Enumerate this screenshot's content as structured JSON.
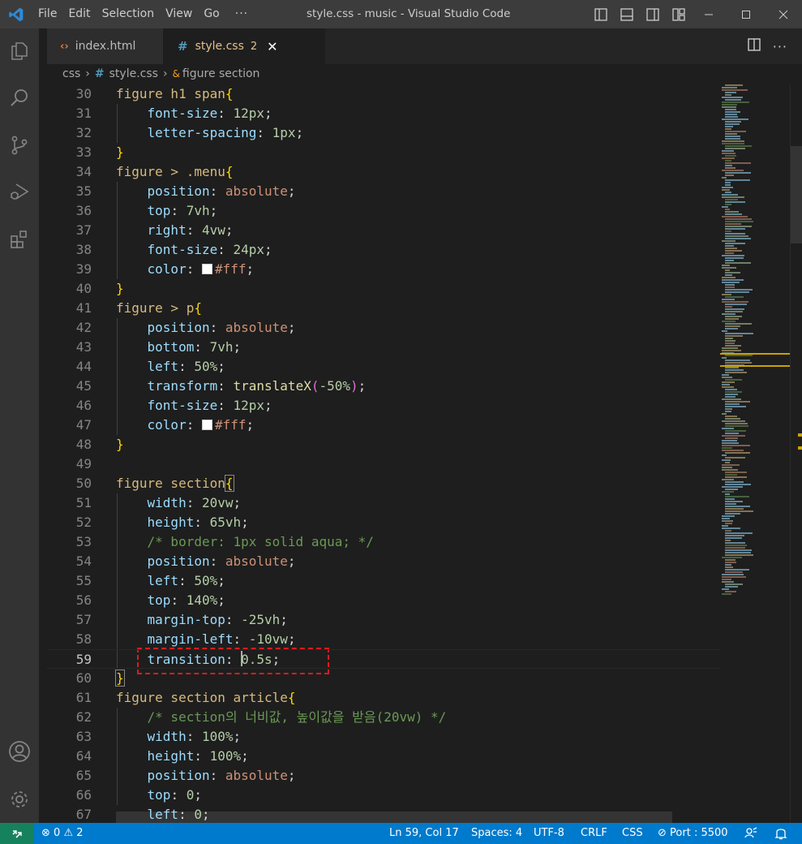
{
  "window": {
    "title": "style.css - music - Visual Studio Code",
    "menu": [
      "File",
      "Edit",
      "Selection",
      "View",
      "Go"
    ],
    "menu_more": "···"
  },
  "tabs": [
    {
      "label": "index.html",
      "icon": "html-file-icon"
    },
    {
      "label": "style.css",
      "icon": "css-file-icon",
      "badge": "2",
      "close": "✕",
      "active": true
    }
  ],
  "breadcrumb": {
    "folder": "css",
    "file": "style.css",
    "symbol": "figure section"
  },
  "editor": {
    "current_line": 59,
    "lines": [
      {
        "n": "30",
        "tokens": [
          [
            "sel",
            "figure h1 span"
          ],
          [
            "brace",
            "{"
          ]
        ]
      },
      {
        "n": "31",
        "tokens": [
          [
            "ws",
            "    "
          ],
          [
            "prop",
            "font-size"
          ],
          [
            "punc",
            ": "
          ],
          [
            "num",
            "12px"
          ],
          [
            "punc",
            ";"
          ]
        ]
      },
      {
        "n": "32",
        "tokens": [
          [
            "ws",
            "    "
          ],
          [
            "prop",
            "letter-spacing"
          ],
          [
            "punc",
            ": "
          ],
          [
            "num",
            "1px"
          ],
          [
            "punc",
            ";"
          ]
        ]
      },
      {
        "n": "33",
        "tokens": [
          [
            "brace",
            "}"
          ]
        ]
      },
      {
        "n": "34",
        "tokens": [
          [
            "sel",
            "figure > .menu"
          ],
          [
            "brace",
            "{"
          ]
        ]
      },
      {
        "n": "35",
        "tokens": [
          [
            "ws",
            "    "
          ],
          [
            "prop",
            "position"
          ],
          [
            "punc",
            ": "
          ],
          [
            "val",
            "absolute"
          ],
          [
            "punc",
            ";"
          ]
        ]
      },
      {
        "n": "36",
        "tokens": [
          [
            "ws",
            "    "
          ],
          [
            "prop",
            "top"
          ],
          [
            "punc",
            ": "
          ],
          [
            "num",
            "7vh"
          ],
          [
            "punc",
            ";"
          ]
        ]
      },
      {
        "n": "37",
        "tokens": [
          [
            "ws",
            "    "
          ],
          [
            "prop",
            "right"
          ],
          [
            "punc",
            ": "
          ],
          [
            "num",
            "4vw"
          ],
          [
            "punc",
            ";"
          ]
        ]
      },
      {
        "n": "38",
        "tokens": [
          [
            "ws",
            "    "
          ],
          [
            "prop",
            "font-size"
          ],
          [
            "punc",
            ": "
          ],
          [
            "num",
            "24px"
          ],
          [
            "punc",
            ";"
          ]
        ]
      },
      {
        "n": "39",
        "tokens": [
          [
            "ws",
            "    "
          ],
          [
            "prop",
            "color"
          ],
          [
            "punc",
            ": "
          ],
          [
            "swatch",
            ""
          ],
          [
            "val",
            "#fff"
          ],
          [
            "punc",
            ";"
          ]
        ]
      },
      {
        "n": "40",
        "tokens": [
          [
            "brace",
            "}"
          ]
        ]
      },
      {
        "n": "41",
        "tokens": [
          [
            "sel",
            "figure > p"
          ],
          [
            "brace",
            "{"
          ]
        ]
      },
      {
        "n": "42",
        "tokens": [
          [
            "ws",
            "    "
          ],
          [
            "prop",
            "position"
          ],
          [
            "punc",
            ": "
          ],
          [
            "val",
            "absolute"
          ],
          [
            "punc",
            ";"
          ]
        ]
      },
      {
        "n": "43",
        "tokens": [
          [
            "ws",
            "    "
          ],
          [
            "prop",
            "bottom"
          ],
          [
            "punc",
            ": "
          ],
          [
            "num",
            "7vh"
          ],
          [
            "punc",
            ";"
          ]
        ]
      },
      {
        "n": "44",
        "tokens": [
          [
            "ws",
            "    "
          ],
          [
            "prop",
            "left"
          ],
          [
            "punc",
            ": "
          ],
          [
            "num",
            "50%"
          ],
          [
            "punc",
            ";"
          ]
        ]
      },
      {
        "n": "45",
        "tokens": [
          [
            "ws",
            "    "
          ],
          [
            "prop",
            "transform"
          ],
          [
            "punc",
            ": "
          ],
          [
            "fn",
            "translateX"
          ],
          [
            "paren",
            "("
          ],
          [
            "num",
            "-50%"
          ],
          [
            "paren",
            ")"
          ],
          [
            "punc",
            ";"
          ]
        ]
      },
      {
        "n": "46",
        "tokens": [
          [
            "ws",
            "    "
          ],
          [
            "prop",
            "font-size"
          ],
          [
            "punc",
            ": "
          ],
          [
            "num",
            "12px"
          ],
          [
            "punc",
            ";"
          ]
        ]
      },
      {
        "n": "47",
        "tokens": [
          [
            "ws",
            "    "
          ],
          [
            "prop",
            "color"
          ],
          [
            "punc",
            ": "
          ],
          [
            "swatch",
            ""
          ],
          [
            "val",
            "#fff"
          ],
          [
            "punc",
            ";"
          ]
        ]
      },
      {
        "n": "48",
        "tokens": [
          [
            "brace",
            "}"
          ]
        ]
      },
      {
        "n": "49",
        "tokens": []
      },
      {
        "n": "50",
        "tokens": [
          [
            "sel",
            "figure section"
          ],
          [
            "bracehl",
            "{"
          ]
        ]
      },
      {
        "n": "51",
        "tokens": [
          [
            "ws",
            "    "
          ],
          [
            "prop",
            "width"
          ],
          [
            "punc",
            ": "
          ],
          [
            "num",
            "20vw"
          ],
          [
            "punc",
            ";"
          ]
        ]
      },
      {
        "n": "52",
        "tokens": [
          [
            "ws",
            "    "
          ],
          [
            "prop",
            "height"
          ],
          [
            "punc",
            ": "
          ],
          [
            "num",
            "65vh"
          ],
          [
            "punc",
            ";"
          ]
        ]
      },
      {
        "n": "53",
        "tokens": [
          [
            "ws",
            "    "
          ],
          [
            "cmt",
            "/* border: 1px solid aqua; */"
          ]
        ]
      },
      {
        "n": "54",
        "tokens": [
          [
            "ws",
            "    "
          ],
          [
            "prop",
            "position"
          ],
          [
            "punc",
            ": "
          ],
          [
            "val",
            "absolute"
          ],
          [
            "punc",
            ";"
          ]
        ]
      },
      {
        "n": "55",
        "tokens": [
          [
            "ws",
            "    "
          ],
          [
            "prop",
            "left"
          ],
          [
            "punc",
            ": "
          ],
          [
            "num",
            "50%"
          ],
          [
            "punc",
            ";"
          ]
        ]
      },
      {
        "n": "56",
        "tokens": [
          [
            "ws",
            "    "
          ],
          [
            "prop",
            "top"
          ],
          [
            "punc",
            ": "
          ],
          [
            "num",
            "140%"
          ],
          [
            "punc",
            ";"
          ]
        ]
      },
      {
        "n": "57",
        "tokens": [
          [
            "ws",
            "    "
          ],
          [
            "prop",
            "margin-top"
          ],
          [
            "punc",
            ": "
          ],
          [
            "num",
            "-25vh"
          ],
          [
            "punc",
            ";"
          ]
        ]
      },
      {
        "n": "58",
        "tokens": [
          [
            "ws",
            "    "
          ],
          [
            "prop",
            "margin-left"
          ],
          [
            "punc",
            ": "
          ],
          [
            "num",
            "-10vw"
          ],
          [
            "punc",
            ";"
          ]
        ]
      },
      {
        "n": "59",
        "tokens": [
          [
            "ws",
            "    "
          ],
          [
            "prop",
            "transition"
          ],
          [
            "punc",
            ": "
          ],
          [
            "cursor",
            ""
          ],
          [
            "num",
            "0.5s"
          ],
          [
            "punc",
            ";"
          ]
        ]
      },
      {
        "n": "60",
        "tokens": [
          [
            "bracehl",
            "}"
          ]
        ]
      },
      {
        "n": "61",
        "tokens": [
          [
            "sel",
            "figure section article"
          ],
          [
            "brace",
            "{"
          ]
        ]
      },
      {
        "n": "62",
        "tokens": [
          [
            "ws",
            "    "
          ],
          [
            "cmt",
            "/* section의 너비값, 높이값을 받음(20vw) */"
          ]
        ]
      },
      {
        "n": "63",
        "tokens": [
          [
            "ws",
            "    "
          ],
          [
            "prop",
            "width"
          ],
          [
            "punc",
            ": "
          ],
          [
            "num",
            "100%"
          ],
          [
            "punc",
            ";"
          ]
        ]
      },
      {
        "n": "64",
        "tokens": [
          [
            "ws",
            "    "
          ],
          [
            "prop",
            "height"
          ],
          [
            "punc",
            ": "
          ],
          [
            "num",
            "100%"
          ],
          [
            "punc",
            ";"
          ]
        ]
      },
      {
        "n": "65",
        "tokens": [
          [
            "ws",
            "    "
          ],
          [
            "prop",
            "position"
          ],
          [
            "punc",
            ": "
          ],
          [
            "val",
            "absolute"
          ],
          [
            "punc",
            ";"
          ]
        ]
      },
      {
        "n": "66",
        "tokens": [
          [
            "ws",
            "    "
          ],
          [
            "prop",
            "top"
          ],
          [
            "punc",
            ": "
          ],
          [
            "num",
            "0"
          ],
          [
            "punc",
            ";"
          ]
        ]
      },
      {
        "n": "67",
        "tokens": [
          [
            "ws",
            "    "
          ],
          [
            "prop",
            "left"
          ],
          [
            "punc",
            ": "
          ],
          [
            "num",
            "0"
          ],
          [
            "punc",
            ";"
          ]
        ]
      }
    ]
  },
  "statusbar": {
    "errors": "0",
    "warnings": "2",
    "position": "Ln 59, Col 17",
    "spaces": "Spaces: 4",
    "encoding": "UTF-8",
    "eol": "CRLF",
    "language": "CSS",
    "port": "Port : 5500"
  },
  "colors": {
    "accent": "#007acc",
    "remote": "#16825d",
    "annotation": "#d81c1c"
  }
}
